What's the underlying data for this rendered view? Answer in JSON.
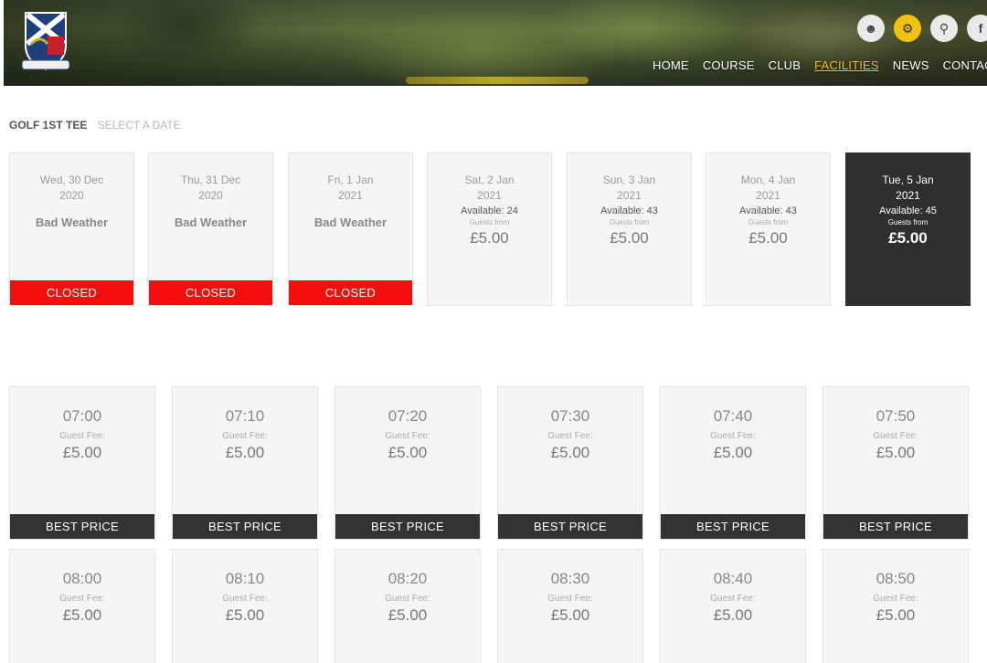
{
  "header": {
    "icons": [
      {
        "name": "user-icon",
        "glyph": "☻"
      },
      {
        "name": "gear-icon",
        "glyph": "⚙"
      },
      {
        "name": "search-icon",
        "glyph": "⚲"
      },
      {
        "name": "facebook-icon",
        "glyph": "f"
      }
    ],
    "nav": [
      {
        "label": "HOME",
        "active": false
      },
      {
        "label": "COURSE",
        "active": false
      },
      {
        "label": "CLUB",
        "active": false
      },
      {
        "label": "FACILITIES",
        "active": true
      },
      {
        "label": "NEWS",
        "active": false
      },
      {
        "label": "CONTACT",
        "active": false
      }
    ],
    "accent_color": "#f2c20f"
  },
  "breadcrumb": {
    "current": "GOLF 1ST TEE",
    "next": "SELECT A DATE"
  },
  "dates": [
    {
      "day": "Wed, 30 Dec",
      "year": "2020",
      "status": "Bad Weather",
      "closed_label": "CLOSED"
    },
    {
      "day": "Thu, 31 Dec",
      "year": "2020",
      "status": "Bad Weather",
      "closed_label": "CLOSED"
    },
    {
      "day": "Fri, 1 Jan",
      "year": "2021",
      "status": "Bad Weather",
      "closed_label": "CLOSED"
    },
    {
      "day": "Sat, 2 Jan",
      "year": "2021",
      "available": "Available: 24",
      "guests_from": "Guests from",
      "price": "£5.00"
    },
    {
      "day": "Sun, 3 Jan",
      "year": "2021",
      "available": "Available: 43",
      "guests_from": "Guests from",
      "price": "£5.00"
    },
    {
      "day": "Mon, 4 Jan",
      "year": "2021",
      "available": "Available: 43",
      "guests_from": "Guests from",
      "price": "£5.00"
    },
    {
      "day": "Tue, 5 Jan",
      "year": "2021",
      "available": "Available: 45",
      "guests_from": "Guests from",
      "price": "£5.00",
      "selected": true
    }
  ],
  "slots": {
    "fee_label": "Guest Fee:",
    "badge_label": "BEST PRICE",
    "row1": [
      {
        "time": "07:00",
        "price": "£5.00"
      },
      {
        "time": "07:10",
        "price": "£5.00"
      },
      {
        "time": "07:20",
        "price": "£5.00"
      },
      {
        "time": "07:30",
        "price": "£5.00"
      },
      {
        "time": "07:40",
        "price": "£5.00"
      },
      {
        "time": "07:50",
        "price": "£5.00"
      }
    ],
    "row2": [
      {
        "time": "08:00",
        "price": "£5.00"
      },
      {
        "time": "08:10",
        "price": "£5.00"
      },
      {
        "time": "08:20",
        "price": "£5.00"
      },
      {
        "time": "08:30",
        "price": "£5.00"
      },
      {
        "time": "08:40",
        "price": "£5.00"
      },
      {
        "time": "08:50",
        "price": "£5.00"
      }
    ]
  },
  "colors": {
    "closed": "#f40e0e",
    "selected": "#2f2f2f",
    "card": "#f4f5f6"
  }
}
